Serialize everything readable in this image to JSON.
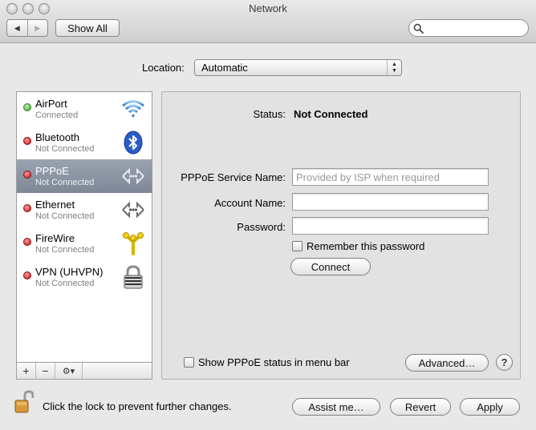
{
  "window": {
    "title": "Network"
  },
  "toolbar": {
    "back_icon": "back-arrow-icon",
    "forward_icon": "forward-arrow-icon",
    "show_all_label": "Show All",
    "search_placeholder": ""
  },
  "location": {
    "label": "Location:",
    "value": "Automatic"
  },
  "services": [
    {
      "name": "AirPort",
      "status": "Connected",
      "status_color": "#3ea328",
      "icon": "wifi-icon"
    },
    {
      "name": "Bluetooth",
      "status": "Not Connected",
      "status_color": "#c80e0e",
      "icon": "bluetooth-icon"
    },
    {
      "name": "PPPoE",
      "status": "Not Connected",
      "status_color": "#c80e0e",
      "icon": "network-arrows-icon",
      "selected": true
    },
    {
      "name": "Ethernet",
      "status": "Not Connected",
      "status_color": "#c80e0e",
      "icon": "network-arrows-icon"
    },
    {
      "name": "FireWire",
      "status": "Not Connected",
      "status_color": "#c80e0e",
      "icon": "firewire-icon"
    },
    {
      "name": "VPN (UHVPN)",
      "status": "Not Connected",
      "status_color": "#c80e0e",
      "icon": "vpn-lock-icon"
    }
  ],
  "list_controls": {
    "add": "+",
    "remove": "−",
    "gear": "⚙▾"
  },
  "detail": {
    "status_label": "Status:",
    "status_value": "Not Connected",
    "service_name_label": "PPPoE Service Name:",
    "service_name_placeholder": "Provided by ISP when required",
    "account_name_label": "Account Name:",
    "account_name_value": "",
    "password_label": "Password:",
    "password_value": "",
    "remember_label": "Remember this password",
    "connect_label": "Connect",
    "show_status_label": "Show PPPoE status in menu bar",
    "advanced_label": "Advanced…",
    "help_label": "?"
  },
  "footer": {
    "lock_text": "Click the lock to prevent further changes.",
    "assist_label": "Assist me…",
    "revert_label": "Revert",
    "apply_label": "Apply"
  }
}
